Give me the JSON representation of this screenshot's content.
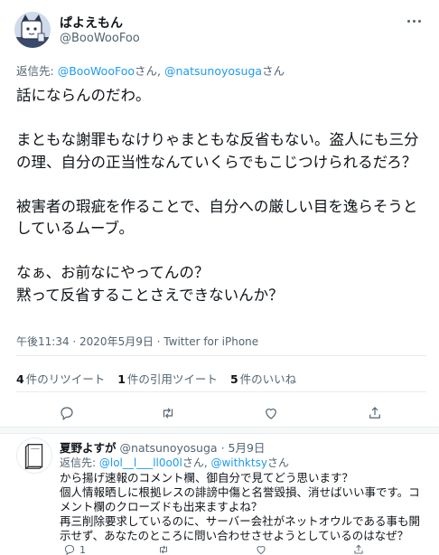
{
  "tweet": {
    "display_name": "ぱよえもん",
    "handle": "@BooWooFoo",
    "reply_prefix": "返信先: ",
    "reply_user1": "@BooWooFoo",
    "reply_sep": "さん, ",
    "reply_user2": "@natsunoyosuga",
    "reply_suffix": "さん",
    "text": "話にならんのだわ。\n\nまともな謝罪もなけりゃまともな反省もない。盗人にも三分の理、自分の正当性なんていくらでもこじつけられるだろ？\n\n被害者の瑕疵を作ることで、自分への厳しい目を逸らそうとしているムーブ。\n\nなぁ、お前なにやってんの？\n黙って反省することさえできないんか？",
    "timestamp": "午後11:34 · 2020年5月9日",
    "meta_sep": " · ",
    "source": "Twitter for iPhone"
  },
  "stats": {
    "retweets_count": "4",
    "retweets_label": "件のリツイート",
    "quotes_count": "1",
    "quotes_label": "件の引用ツイート",
    "likes_count": "5",
    "likes_label": "件のいいね"
  },
  "icons": {
    "reply": "reply-icon",
    "retweet": "retweet-icon",
    "like": "heart-icon",
    "share": "share-icon",
    "more": "more-icon"
  },
  "reply_tweet": {
    "display_name": "夏野よすが",
    "handle": "@natsunoyosuga",
    "date": " · 5月9日",
    "reply_prefix": "返信先: ",
    "reply_user1": "@lol__l___ll0o0l",
    "reply_sep": "さん, ",
    "reply_user2": "@withktsy",
    "reply_suffix": "さん",
    "text": "から揚げ速報のコメント欄、御自分で見てどう思います？\n個人情報晒しに根拠レスの誹謗中傷と名誉毀損、消せばいい事です。コメント欄のクローズドも出来ますよね？\n再三削除要求しているのに、サーバー会社がネットオウルである事も開示せず、あなたのところに問い合わせさせようとしているのはなぜ？",
    "reply_count": "1"
  },
  "colors": {
    "accent": "#1d9bf0",
    "text": "#0f1419",
    "secondary": "#536471",
    "border": "#e6ecf0"
  }
}
